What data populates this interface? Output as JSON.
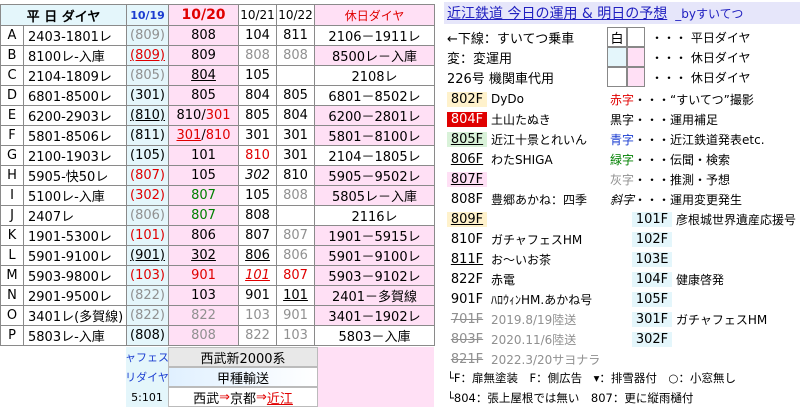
{
  "header": {
    "weekday": "平 日 ダイヤ",
    "d1019": "10/19",
    "d1020": "10/20",
    "d1021": "10/21",
    "d1022": "10/22",
    "holiday": "休日ダイヤ",
    "title": "近江鉄道 今日の運用 & 明日の予想",
    "by": "_byすいてつ"
  },
  "rows": [
    {
      "k": "A",
      "w": "2403-1801レ",
      "p": "(809)",
      "t": "808",
      "a": "104",
      "b": "811",
      "h": "2106－1911レ"
    },
    {
      "k": "B",
      "w": "8100レ-入庫",
      "p": "(809)",
      "t": "809",
      "a": "808",
      "b": "808",
      "h": "8500レ－入庫"
    },
    {
      "k": "C",
      "w": "2104-1809レ",
      "p": "(805)",
      "t": "804",
      "a": "105",
      "b": "",
      "h": "2108レ"
    },
    {
      "k": "D",
      "w": "6801-8500レ",
      "p": "(301)",
      "t": "805",
      "a": "804",
      "b": "805",
      "h": "6801－8502レ"
    },
    {
      "k": "E",
      "w": "6200-2903レ",
      "p": "(810)",
      "t": "810/301",
      "a": "805",
      "b": "804",
      "h": "6200－2801レ"
    },
    {
      "k": "F",
      "w": "5801-8506レ",
      "p": "(811)",
      "t": "301/810",
      "a": "301",
      "b": "301",
      "h": "5801－8100レ"
    },
    {
      "k": "G",
      "w": "2100-1903レ",
      "p": "(105)",
      "t": "101",
      "a": "810",
      "b": "301",
      "h": "2104－1805レ"
    },
    {
      "k": "H",
      "w": "5905-快50レ",
      "p": "(807)",
      "t": "105",
      "a": "302",
      "b": "810",
      "h": "5905－9502レ"
    },
    {
      "k": "I",
      "w": "5100レ-入庫",
      "p": "(302)",
      "t": "807",
      "a": "105",
      "b": "808",
      "h": "5805レ－入庫"
    },
    {
      "k": "J",
      "w": "2407レ",
      "p": "(806)",
      "t": "807",
      "a": "808",
      "b": "",
      "h": "2116レ"
    },
    {
      "k": "K",
      "w": "1901-5300レ",
      "p": "(101)",
      "t": "806",
      "a": "807",
      "b": "807",
      "h": "1901－5915レ"
    },
    {
      "k": "L",
      "w": "5901-9100レ",
      "p": "(901)",
      "t": "302",
      "a": "806",
      "b": "806",
      "h": "5901－9100レ"
    },
    {
      "k": "M",
      "w": "5903-9800レ",
      "p": "(103)",
      "t": "901",
      "a": "101",
      "b": "807",
      "h": "5903－9102レ"
    },
    {
      "k": "N",
      "w": "2901-9500レ",
      "p": "(822)",
      "t": "103",
      "a": "901",
      "b": "101",
      "h": "2401－多賀線"
    },
    {
      "k": "O",
      "w": "3401レ(多賀線)",
      "p": "(822)",
      "t": "822",
      "a": "103",
      "b": "901",
      "h": "3401－1902レ"
    },
    {
      "k": "P",
      "w": "5803レ-入庫",
      "p": "(808)",
      "t": "808",
      "a": "822",
      "b": "103",
      "h": "5803－入庫"
    }
  ],
  "bottom": {
    "left1": "ャフェス",
    "left2": "リダイヤ",
    "left3": "5:101",
    "mid1": "西武新2000系",
    "mid2": "甲種輸送",
    "mid3a": "西武",
    "mid3b": "京都",
    "mid3c": "近江"
  },
  "legend": {
    "l1": "←下線：すいてつ乗車",
    "l2": "変：変運用",
    "l3": "226号 機関車代用",
    "l4": "・・・ 平日ダイヤ",
    "l5": "・・・ 休日ダイヤ",
    "l6": "・・・ 休日ダイヤ",
    "l4box": "白",
    "s1": "赤字",
    "s1t": "・・・“すいてつ”撮影",
    "s2": "黒字",
    "s2t": "・・・運用補足",
    "s3": "青字",
    "s3t": "・・・近江鉄道発表etc.",
    "s4": "緑字",
    "s4t": "・・・伝聞・検索",
    "s5": "灰字",
    "s5t": "・・・推測・予想",
    "s6": "斜字",
    "s6t": "・・・運用変更発生"
  },
  "cars": [
    {
      "id": "802F",
      "name": "DyDo"
    },
    {
      "id": "804F",
      "name": "土山たぬき"
    },
    {
      "id": "805F",
      "name": "近江十景とれいん"
    },
    {
      "id": "806F",
      "name": "わたSHIGA"
    },
    {
      "id": "807F",
      "name": ""
    },
    {
      "id": "808F",
      "name": "豊郷あかね：四季"
    },
    {
      "id": "809F",
      "name": ""
    },
    {
      "id": "810F",
      "name": "ガチャフェスHM"
    },
    {
      "id": "811F",
      "name": "お～いお茶"
    },
    {
      "id": "822F",
      "name": "赤電"
    },
    {
      "id": "901F",
      "name": "ﾊﾛｳｨﾝHM.あかね号"
    },
    {
      "id": "701F",
      "name": "2019.8/19陸送"
    },
    {
      "id": "803F",
      "name": "2020.11/6陸送"
    },
    {
      "id": "821F",
      "name": "2022.3/20サヨナラ"
    }
  ],
  "locos": [
    {
      "id": "101F",
      "name": "彦根城世界遺産応援号"
    },
    {
      "id": "102F",
      "name": ""
    },
    {
      "id": "103E",
      "name": ""
    },
    {
      "id": "104F",
      "name": "健康啓発"
    },
    {
      "id": "105F",
      "name": ""
    },
    {
      "id": "301F",
      "name": "ガチャフェスHM"
    },
    {
      "id": "302F",
      "name": ""
    }
  ],
  "footer": {
    "f1": "└F：扉無塗装　F：側広告　▾：排雪器付　○：小窓無し",
    "f2": "└804：張上屋根では無い　807：更に縦雨樋付"
  }
}
